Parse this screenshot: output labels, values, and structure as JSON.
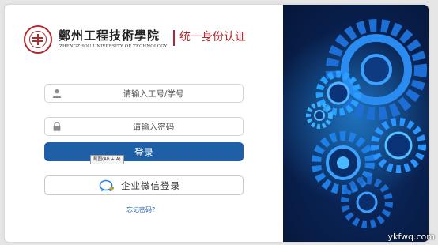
{
  "branding": {
    "university_name": "鄭州工程技術學院",
    "university_name_en": "ZHENGZHOU UNIVERSITY OF TECHNOLOGY",
    "portal_title": "统一身份认证",
    "accent_color": "#b1282f"
  },
  "form": {
    "username_placeholder": "请输入工号/学号",
    "username_icon": "user-icon",
    "password_placeholder": "请输入密码",
    "password_icon": "lock-icon",
    "login_label": "登录",
    "login_color": "#1f5fa8",
    "tooltip_text": "截图(Alt + A)",
    "wechat_label": "企业微信登录",
    "wechat_icon": "wechat-work-icon",
    "forgot_label": "忘记密码?"
  },
  "decoration": {
    "panel_image": "blue-gears-illustration",
    "background_color": "#0a2354",
    "gear_color": "#1e90ff"
  },
  "watermark": "ykfwq.com"
}
